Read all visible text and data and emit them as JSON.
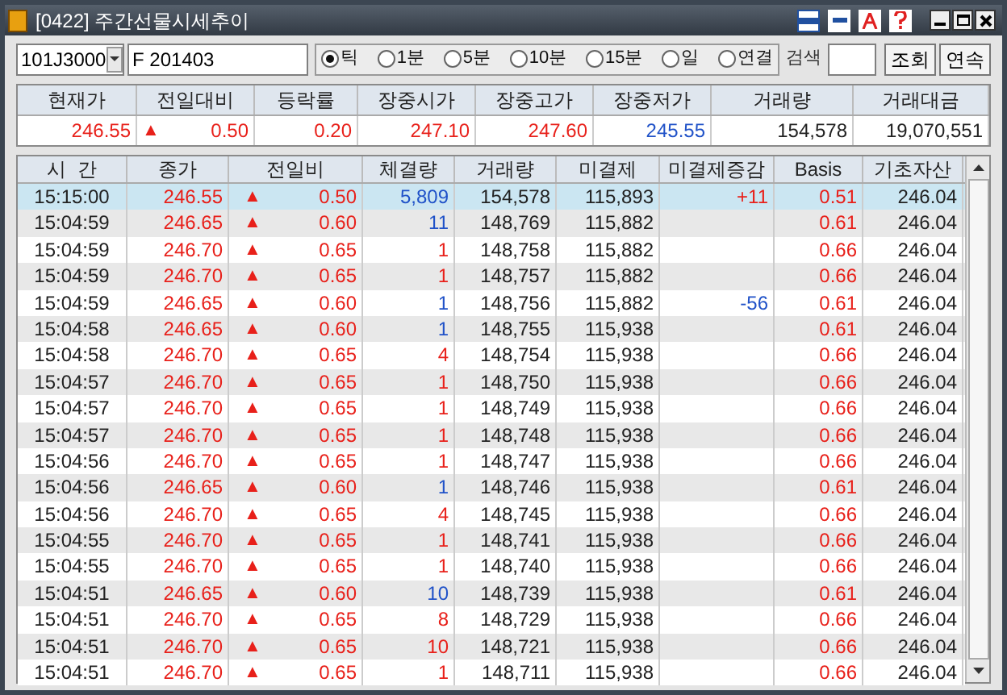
{
  "window": {
    "title": "[0422] 주간선물시세추이"
  },
  "toolbar": {
    "code": "101J3000",
    "name": "F 201403",
    "periods": [
      {
        "label": "틱",
        "selected": true
      },
      {
        "label": "1분",
        "selected": false
      },
      {
        "label": "5분",
        "selected": false
      },
      {
        "label": "10분",
        "selected": false
      },
      {
        "label": "15분",
        "selected": false
      },
      {
        "label": "일",
        "selected": false
      },
      {
        "label": "연결",
        "selected": false
      }
    ],
    "search_label": "검색",
    "buttons": [
      "조회",
      "연속"
    ]
  },
  "summary": {
    "columns": [
      "현재가",
      "전일대비",
      "등락률",
      "장중시가",
      "장중고가",
      "장중저가",
      "거래량",
      "거래대금"
    ],
    "values": [
      {
        "text": "246.55",
        "kind": "up"
      },
      {
        "text": "0.50",
        "kind": "up",
        "arrow": "▲"
      },
      {
        "text": "0.20",
        "kind": "up"
      },
      {
        "text": "247.10",
        "kind": "up"
      },
      {
        "text": "247.60",
        "kind": "up"
      },
      {
        "text": "245.55",
        "kind": "down"
      },
      {
        "text": "154,578",
        "kind": "flat"
      },
      {
        "text": "19,070,551",
        "kind": "flat"
      }
    ]
  },
  "table": {
    "columns": [
      "시  간",
      "종가",
      "전일비",
      "체결량",
      "거래량",
      "미결제",
      "미결제증감",
      "Basis",
      "기초자산"
    ],
    "rows": [
      {
        "selected": true,
        "time": "15:15:00",
        "price": "246.55",
        "arrow": "▲",
        "change": "0.50",
        "qty": {
          "text": "5,809",
          "color": "#2052c8"
        },
        "volume": "154,578",
        "oi": "115,893",
        "oi_change": {
          "text": "+11",
          "kind": "up"
        },
        "basis": "0.51",
        "underlying": "246.04"
      },
      {
        "selected": false,
        "time": "15:04:59",
        "price": "246.65",
        "arrow": "▲",
        "change": "0.60",
        "qty": {
          "text": "11",
          "color": "#2052c8"
        },
        "volume": "148,769",
        "oi": "115,882",
        "basis": "0.61",
        "underlying": "246.04"
      },
      {
        "selected": false,
        "time": "15:04:59",
        "price": "246.70",
        "arrow": "▲",
        "change": "0.65",
        "qty": {
          "text": "1",
          "color": "#e8201a"
        },
        "volume": "148,758",
        "oi": "115,882",
        "basis": "0.66",
        "underlying": "246.04"
      },
      {
        "selected": false,
        "time": "15:04:59",
        "price": "246.70",
        "arrow": "▲",
        "change": "0.65",
        "qty": {
          "text": "1",
          "color": "#e8201a"
        },
        "volume": "148,757",
        "oi": "115,882",
        "basis": "0.66",
        "underlying": "246.04"
      },
      {
        "selected": false,
        "time": "15:04:59",
        "price": "246.65",
        "arrow": "▲",
        "change": "0.60",
        "qty": {
          "text": "1",
          "color": "#2052c8"
        },
        "volume": "148,756",
        "oi": "115,882",
        "oi_change": {
          "text": "-56",
          "kind": "down"
        },
        "basis": "0.61",
        "underlying": "246.04"
      },
      {
        "selected": false,
        "time": "15:04:58",
        "price": "246.65",
        "arrow": "▲",
        "change": "0.60",
        "qty": {
          "text": "1",
          "color": "#2052c8"
        },
        "volume": "148,755",
        "oi": "115,938",
        "basis": "0.61",
        "underlying": "246.04"
      },
      {
        "selected": false,
        "time": "15:04:58",
        "price": "246.70",
        "arrow": "▲",
        "change": "0.65",
        "qty": {
          "text": "4",
          "color": "#e8201a"
        },
        "volume": "148,754",
        "oi": "115,938",
        "basis": "0.66",
        "underlying": "246.04"
      },
      {
        "selected": false,
        "time": "15:04:57",
        "price": "246.70",
        "arrow": "▲",
        "change": "0.65",
        "qty": {
          "text": "1",
          "color": "#e8201a"
        },
        "volume": "148,750",
        "oi": "115,938",
        "basis": "0.66",
        "underlying": "246.04"
      },
      {
        "selected": false,
        "time": "15:04:57",
        "price": "246.70",
        "arrow": "▲",
        "change": "0.65",
        "qty": {
          "text": "1",
          "color": "#e8201a"
        },
        "volume": "148,749",
        "oi": "115,938",
        "basis": "0.66",
        "underlying": "246.04"
      },
      {
        "selected": false,
        "time": "15:04:57",
        "price": "246.70",
        "arrow": "▲",
        "change": "0.65",
        "qty": {
          "text": "1",
          "color": "#e8201a"
        },
        "volume": "148,748",
        "oi": "115,938",
        "basis": "0.66",
        "underlying": "246.04"
      },
      {
        "selected": false,
        "time": "15:04:56",
        "price": "246.70",
        "arrow": "▲",
        "change": "0.65",
        "qty": {
          "text": "1",
          "color": "#e8201a"
        },
        "volume": "148,747",
        "oi": "115,938",
        "basis": "0.66",
        "underlying": "246.04"
      },
      {
        "selected": false,
        "time": "15:04:56",
        "price": "246.65",
        "arrow": "▲",
        "change": "0.60",
        "qty": {
          "text": "1",
          "color": "#2052c8"
        },
        "volume": "148,746",
        "oi": "115,938",
        "basis": "0.61",
        "underlying": "246.04"
      },
      {
        "selected": false,
        "time": "15:04:56",
        "price": "246.70",
        "arrow": "▲",
        "change": "0.65",
        "qty": {
          "text": "4",
          "color": "#e8201a"
        },
        "volume": "148,745",
        "oi": "115,938",
        "basis": "0.66",
        "underlying": "246.04"
      },
      {
        "selected": false,
        "time": "15:04:55",
        "price": "246.70",
        "arrow": "▲",
        "change": "0.65",
        "qty": {
          "text": "1",
          "color": "#e8201a"
        },
        "volume": "148,741",
        "oi": "115,938",
        "basis": "0.66",
        "underlying": "246.04"
      },
      {
        "selected": false,
        "time": "15:04:55",
        "price": "246.70",
        "arrow": "▲",
        "change": "0.65",
        "qty": {
          "text": "1",
          "color": "#e8201a"
        },
        "volume": "148,740",
        "oi": "115,938",
        "basis": "0.66",
        "underlying": "246.04"
      },
      {
        "selected": false,
        "time": "15:04:51",
        "price": "246.65",
        "arrow": "▲",
        "change": "0.60",
        "qty": {
          "text": "10",
          "color": "#2052c8"
        },
        "volume": "148,739",
        "oi": "115,938",
        "basis": "0.61",
        "underlying": "246.04"
      },
      {
        "selected": false,
        "time": "15:04:51",
        "price": "246.70",
        "arrow": "▲",
        "change": "0.65",
        "qty": {
          "text": "8",
          "color": "#e8201a"
        },
        "volume": "148,729",
        "oi": "115,938",
        "basis": "0.66",
        "underlying": "246.04"
      },
      {
        "selected": false,
        "time": "15:04:51",
        "price": "246.70",
        "arrow": "▲",
        "change": "0.65",
        "qty": {
          "text": "10",
          "color": "#e8201a"
        },
        "volume": "148,721",
        "oi": "115,938",
        "basis": "0.66",
        "underlying": "246.04"
      },
      {
        "selected": false,
        "time": "15:04:51",
        "price": "246.70",
        "arrow": "▲",
        "change": "0.65",
        "qty": {
          "text": "1",
          "color": "#e8201a"
        },
        "volume": "148,711",
        "oi": "115,938",
        "basis": "0.66",
        "underlying": "246.04"
      }
    ]
  }
}
